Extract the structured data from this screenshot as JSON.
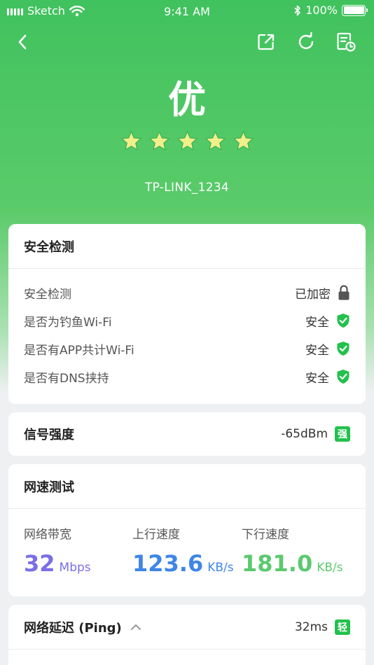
{
  "status_bar": {
    "carrier": "Sketch",
    "time": "9:41 AM",
    "battery": "100%"
  },
  "header": {
    "grade": "优",
    "star_count": 5,
    "ssid": "TP-LINK_1234"
  },
  "security": {
    "title": "安全检测",
    "rows": [
      {
        "label": "安全检测",
        "value": "已加密",
        "icon": "lock-icon"
      },
      {
        "label": "是否为钓鱼Wi-Fi",
        "value": "安全",
        "icon": "shield-check-icon"
      },
      {
        "label": "是否有APP共计Wi-Fi",
        "value": "安全",
        "icon": "shield-check-icon"
      },
      {
        "label": "是否有DNS挟持",
        "value": "安全",
        "icon": "shield-check-icon"
      }
    ]
  },
  "signal": {
    "title": "信号强度",
    "value": "-65dBm",
    "badge": "强"
  },
  "speed": {
    "title": "网速测试",
    "bandwidth": {
      "label": "网络带宽",
      "value": "32",
      "unit": "Mbps",
      "color": "#7b6ee6"
    },
    "upload": {
      "label": "上行速度",
      "value": "123.6",
      "unit": "KB/s",
      "color": "#3f86e6"
    },
    "download": {
      "label": "下行速度",
      "value": "181.0",
      "unit": "KB/s",
      "color": "#5cc96f"
    }
  },
  "ping": {
    "title": "网络延迟 (Ping)",
    "value": "32ms",
    "badge": "轻"
  },
  "colors": {
    "accent_green": "#22c14d",
    "header_green": "#40c25e",
    "star_yellow": "#f2ee8a"
  }
}
